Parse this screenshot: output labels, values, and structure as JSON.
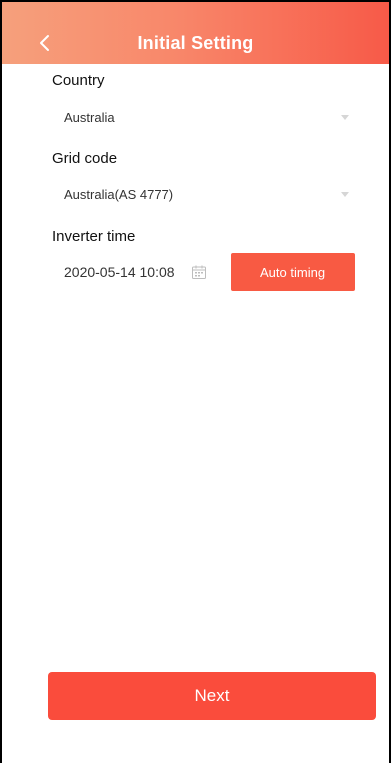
{
  "header": {
    "title": "Initial Setting",
    "back_icon": "chevron-left-icon",
    "gradient": [
      "#f6a07c",
      "#f75a48"
    ]
  },
  "form": {
    "country": {
      "label": "Country",
      "value": "Australia"
    },
    "grid_code": {
      "label": "Grid code",
      "value": "Australia(AS 4777)"
    },
    "inverter_time": {
      "label": "Inverter time",
      "value": "2020-05-14 10:08",
      "calendar_icon": "calendar-icon",
      "auto_button_label": "Auto timing"
    }
  },
  "footer": {
    "next_label": "Next"
  },
  "colors": {
    "accent": "#f85a43",
    "next": "#fa4c3c"
  }
}
